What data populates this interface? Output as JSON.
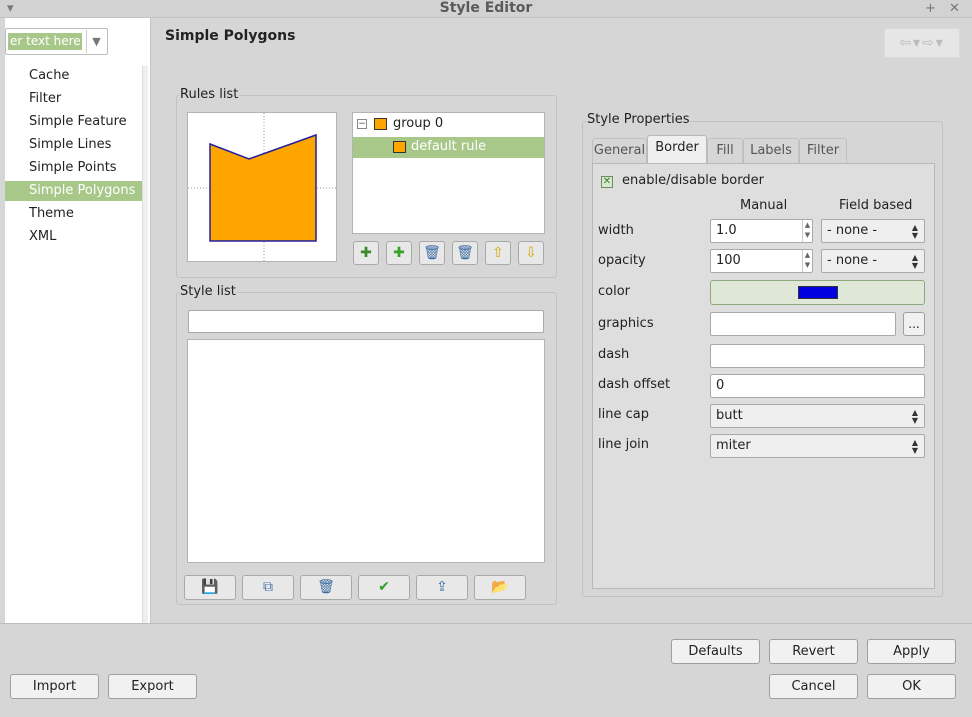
{
  "window": {
    "title": "Style Editor"
  },
  "sidebar": {
    "filter_placeholder": "er text here",
    "items": [
      {
        "label": "Cache"
      },
      {
        "label": "Filter"
      },
      {
        "label": "Simple Feature"
      },
      {
        "label": "Simple Lines"
      },
      {
        "label": "Simple Points"
      },
      {
        "label": "Simple Polygons",
        "selected": true
      },
      {
        "label": "Theme"
      },
      {
        "label": "XML"
      }
    ]
  },
  "main": {
    "title": "Simple Polygons",
    "rules_list": {
      "label": "Rules list",
      "tree": {
        "group": "group 0",
        "rule": "default rule"
      },
      "preview_fill_color": "#ffa500",
      "preview_stroke_color": "#2020a0"
    },
    "style_list": {
      "label": "Style list",
      "input_value": ""
    },
    "style_properties": {
      "label": "Style Properties",
      "tabs": [
        "General",
        "Border",
        "Fill",
        "Labels",
        "Filter"
      ],
      "active_tab": "Border",
      "enable_label": "enable/disable border",
      "headers": {
        "manual": "Manual",
        "field_based": "Field based"
      },
      "width": {
        "label": "width",
        "value": "1.0",
        "field": "- none -"
      },
      "opacity": {
        "label": "opacity",
        "value": "100",
        "field": "- none -"
      },
      "color": {
        "label": "color",
        "value": "#0000e0"
      },
      "graphics": {
        "label": "graphics",
        "value": "",
        "browse": "..."
      },
      "dash": {
        "label": "dash",
        "value": ""
      },
      "dash_offset": {
        "label": "dash offset",
        "value": "0"
      },
      "line_cap": {
        "label": "line cap",
        "value": "butt"
      },
      "line_join": {
        "label": "line join",
        "value": "miter"
      }
    }
  },
  "footer": {
    "defaults": "Defaults",
    "revert": "Revert",
    "apply": "Apply",
    "import": "Import",
    "export": "Export",
    "cancel": "Cancel",
    "ok": "OK"
  }
}
